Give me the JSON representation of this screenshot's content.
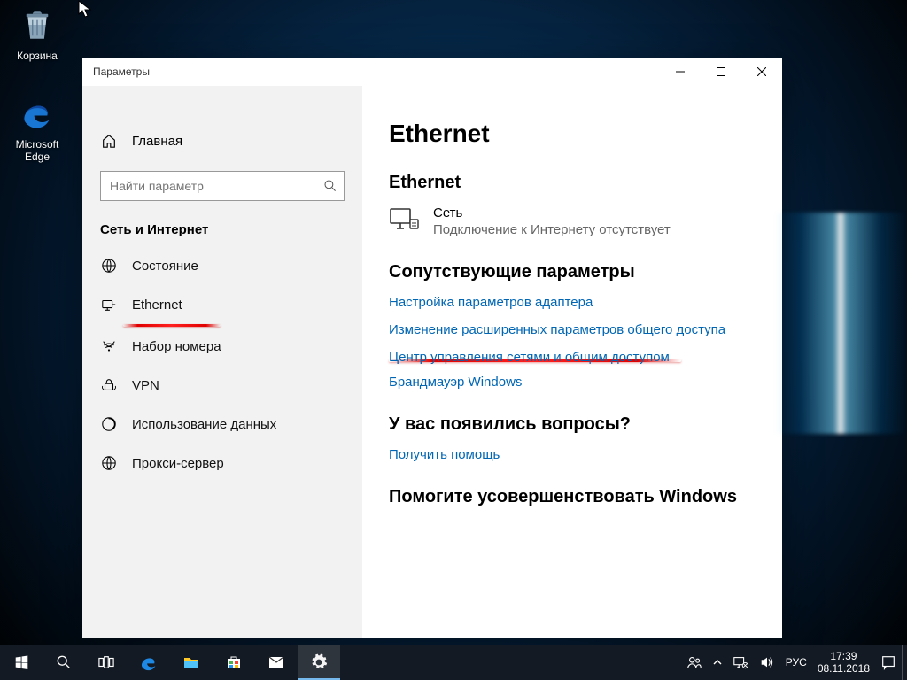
{
  "desktop": {
    "icons": {
      "recycle": "Корзина",
      "edge": "Microsoft Edge"
    }
  },
  "window": {
    "title": "Параметры"
  },
  "sidebar": {
    "home_label": "Главная",
    "search_placeholder": "Найти параметр",
    "section_header": "Сеть и Интернет",
    "items": [
      {
        "label": "Состояние"
      },
      {
        "label": "Ethernet"
      },
      {
        "label": "Набор номера"
      },
      {
        "label": "VPN"
      },
      {
        "label": "Использование данных"
      },
      {
        "label": "Прокси-сервер"
      }
    ]
  },
  "main": {
    "title": "Ethernet",
    "section_ethernet": "Ethernet",
    "network": {
      "name": "Сеть",
      "status": "Подключение к Интернету отсутствует"
    },
    "section_related": "Сопутствующие параметры",
    "links": {
      "adapter": "Настройка параметров адаптера",
      "sharing": "Изменение расширенных параметров общего доступа",
      "center": "Центр управления сетями и общим доступом",
      "firewall": "Брандмауэр Windows"
    },
    "section_questions": "У вас появились вопросы?",
    "help_link": "Получить помощь",
    "section_improve": "Помогите усовершенствовать Windows"
  },
  "taskbar": {
    "lang": "РУС",
    "time": "17:39",
    "date": "08.11.2018"
  }
}
